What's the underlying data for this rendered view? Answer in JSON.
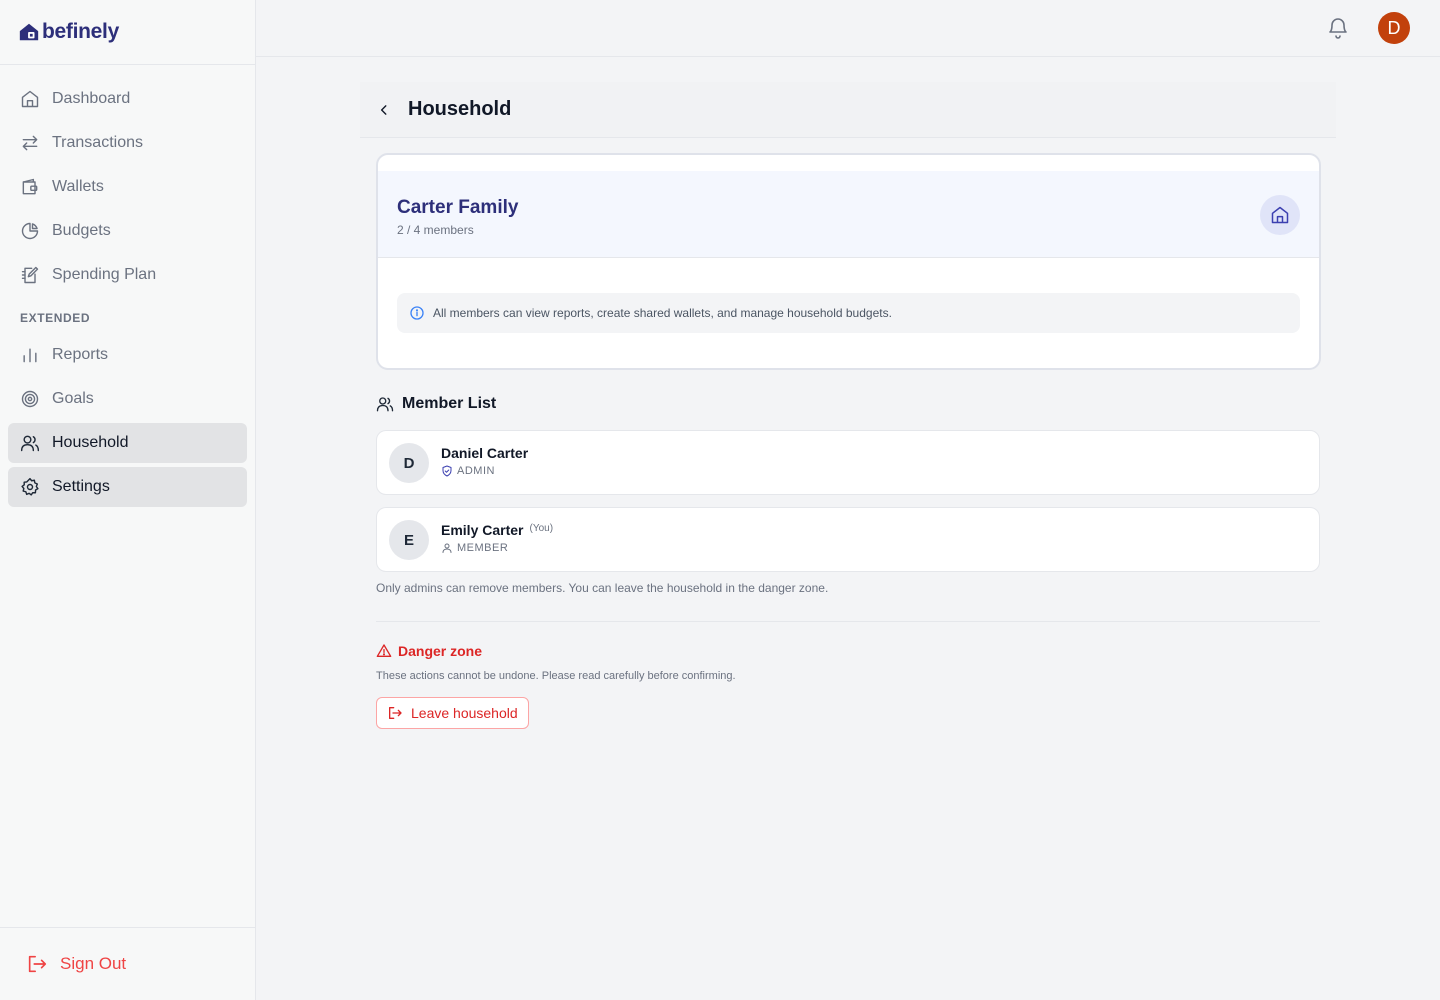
{
  "brand": {
    "name": "befinely",
    "color": "#2d2f7a"
  },
  "sidebar": {
    "items": [
      {
        "label": "Dashboard",
        "icon": "home-icon"
      },
      {
        "label": "Transactions",
        "icon": "arrows-swap-icon"
      },
      {
        "label": "Wallets",
        "icon": "wallet-icon"
      },
      {
        "label": "Budgets",
        "icon": "pie-chart-icon"
      },
      {
        "label": "Spending Plan",
        "icon": "notebook-pen-icon"
      }
    ],
    "section_label": "EXTENDED",
    "extended_items": [
      {
        "label": "Reports",
        "icon": "bar-chart-icon"
      },
      {
        "label": "Goals",
        "icon": "target-icon"
      },
      {
        "label": "Household",
        "icon": "users-icon",
        "active": true
      },
      {
        "label": "Settings",
        "icon": "gear-icon",
        "active": true
      }
    ],
    "sign_out": "Sign Out"
  },
  "topbar": {
    "avatar_initial": "D",
    "avatar_color": "#c2410c"
  },
  "page": {
    "title": "Household",
    "household": {
      "name": "Carter Family",
      "member_count": "2 / 4 members",
      "info": "All members can view reports, create shared wallets, and manage household budgets."
    },
    "member_list": {
      "title": "Member List",
      "members": [
        {
          "initial": "D",
          "name": "Daniel Carter",
          "role": "ADMIN",
          "tag": ""
        },
        {
          "initial": "E",
          "name": "Emily Carter",
          "role": "MEMBER",
          "tag": "(You)"
        }
      ],
      "note": "Only admins can remove members. You can leave the household in the danger zone."
    },
    "danger_zone": {
      "title": "Danger zone",
      "description": "These actions cannot be undone. Please read carefully before confirming.",
      "leave_button": "Leave household",
      "color": "#dc2626"
    }
  }
}
